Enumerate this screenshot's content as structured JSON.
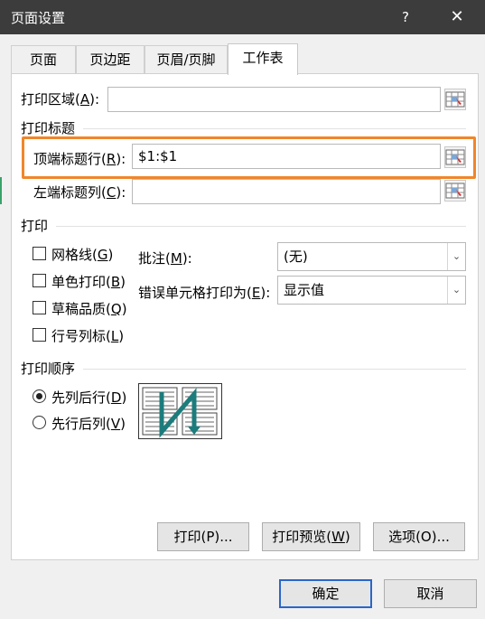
{
  "window": {
    "title": "页面设置",
    "help_label": "?",
    "close_label": "✕"
  },
  "tabs": [
    {
      "label": "页面"
    },
    {
      "label": "页边距"
    },
    {
      "label": "页眉/页脚"
    },
    {
      "label": "工作表"
    }
  ],
  "print_area": {
    "label": "打印区域",
    "key": "A",
    "value": ""
  },
  "print_titles": {
    "section": "打印标题",
    "rows_label": "顶端标题行",
    "rows_key": "R",
    "rows_value": "$1:$1",
    "cols_label": "左端标题列",
    "cols_key": "C",
    "cols_value": ""
  },
  "print": {
    "section": "打印",
    "checkboxes": [
      {
        "label": "网格线",
        "key": "G",
        "checked": false
      },
      {
        "label": "单色打印",
        "key": "B",
        "checked": false
      },
      {
        "label": "草稿品质",
        "key": "Q",
        "checked": false
      },
      {
        "label": "行号列标",
        "key": "L",
        "checked": false
      }
    ],
    "comments_label": "批注",
    "comments_key": "M",
    "comments_value": "(无)",
    "errors_label": "错误单元格打印为",
    "errors_key": "E",
    "errors_value": "显示值"
  },
  "order": {
    "section": "打印顺序",
    "options": [
      {
        "label": "先列后行",
        "key": "D",
        "selected": true
      },
      {
        "label": "先行后列",
        "key": "V",
        "selected": false
      }
    ]
  },
  "buttons": {
    "print": "打印(P)...",
    "preview_label": "打印预览",
    "preview_key": "W",
    "options": "选项(O)...",
    "ok": "确定",
    "cancel": "取消"
  },
  "icons": {
    "ref": "range-select-icon",
    "order": "page-order-icon"
  },
  "colors": {
    "accent": "#2a66c9",
    "highlight": "#f0862a",
    "titlebar": "#3c3c3c"
  }
}
